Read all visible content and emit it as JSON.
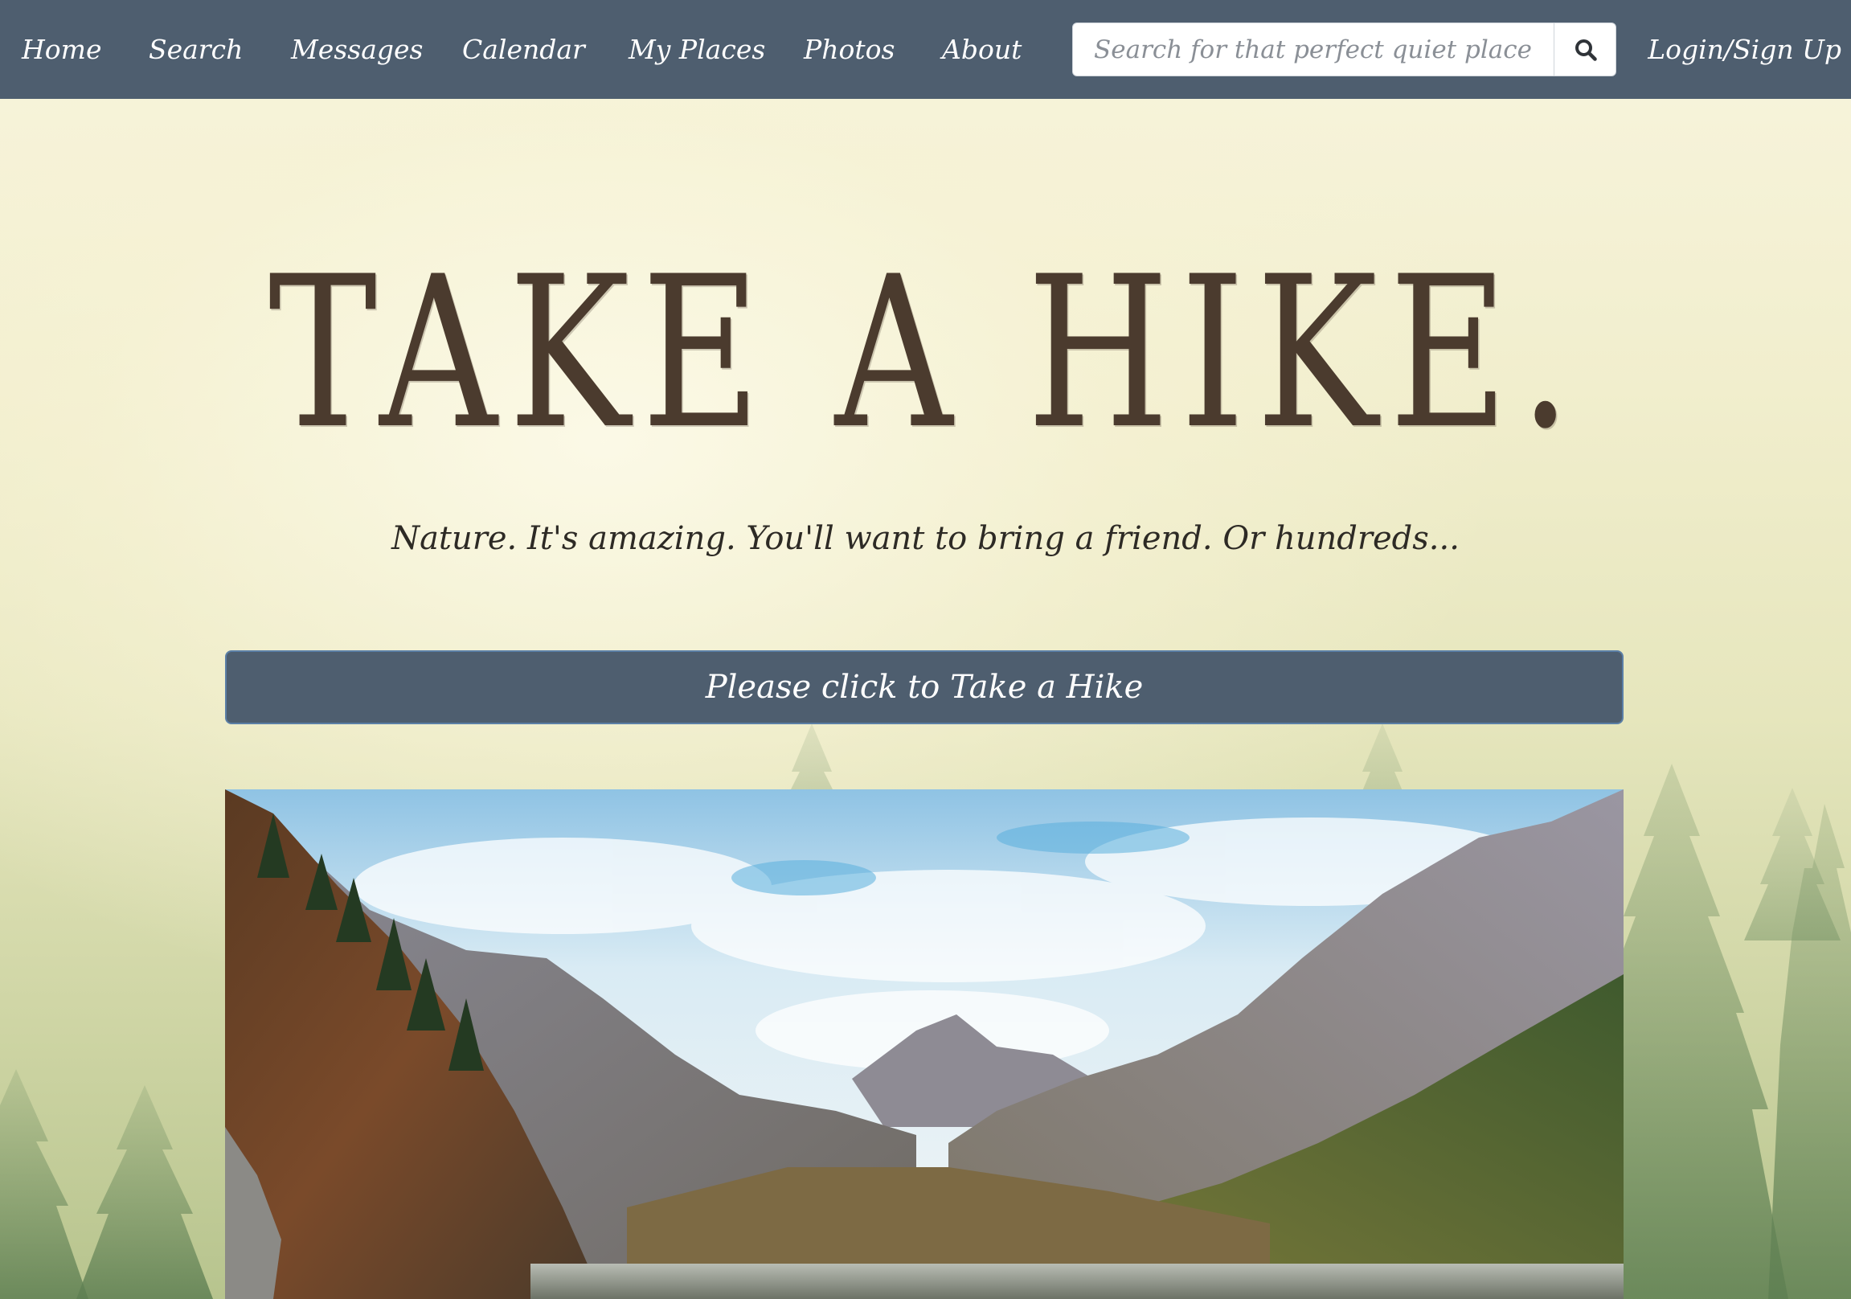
{
  "nav": {
    "links": [
      "Home",
      "Search",
      "Messages",
      "Calendar",
      "My Places",
      "Photos",
      "About"
    ],
    "search_placeholder": "Search for that perfect quiet place",
    "search_icon": "search-icon",
    "login_label": "Login/Sign Up"
  },
  "hero": {
    "title": "Take a Hike.",
    "subtitle": "Nature. It's amazing. You'll want to bring a friend. Or hundreds...",
    "cta_label": "Please click to Take a Hike"
  },
  "colors": {
    "navbar": "#4e5e6f",
    "title_text": "#4b3b2e",
    "button": "#4e5e6f",
    "background": "#f4f0d6"
  }
}
